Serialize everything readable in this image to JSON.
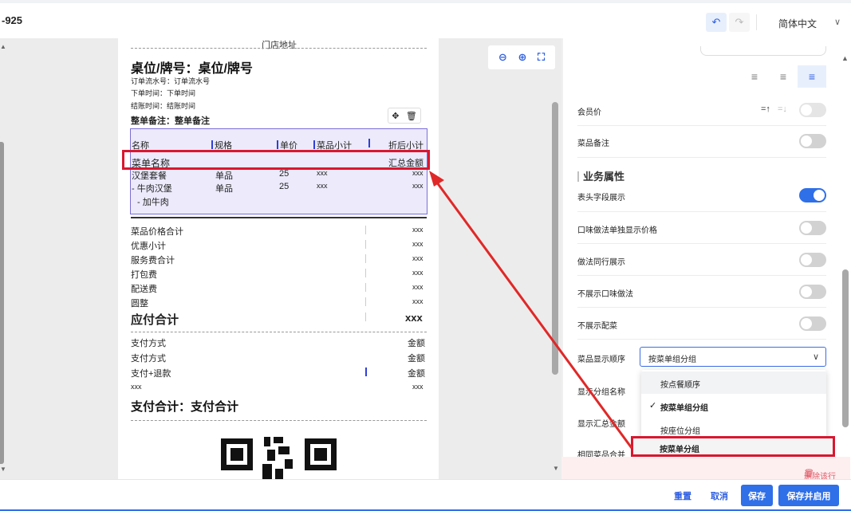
{
  "header": {
    "title": "-925",
    "undo_icon": "undo-icon",
    "redo_icon": "redo-icon",
    "language": "简体中文"
  },
  "zoom_tools": {
    "zoom_out": "zoom-out-icon",
    "zoom_in": "zoom-in-icon",
    "fit": "fit-screen-icon"
  },
  "receipt": {
    "store_address": "门店地址",
    "table_no": "桌位/牌号：桌位/牌号",
    "serial": "订单流水号：订单流水号",
    "order_time": "下单时间：下单时间",
    "checkout_time": "结账时间：结账时间",
    "order_note": "整单备注：整单备注",
    "item_headers": [
      "名称",
      "规格",
      "单价",
      "菜品小计",
      "折后小计"
    ],
    "group_name": "菜单名称",
    "group_total": "汇总金额",
    "items": [
      {
        "name": "汉堡套餐",
        "spec": "单品",
        "price": "25",
        "subtotal": "xxx",
        "discounted": "xxx"
      },
      {
        "name": "- 牛肉汉堡",
        "spec": "单品",
        "price": "25",
        "subtotal": "xxx",
        "discounted": "xxx"
      }
    ],
    "addon": "- 加牛肉",
    "totals": [
      {
        "label": "菜品价格合计",
        "value": "xxx"
      },
      {
        "label": "优惠小计",
        "value": "xxx"
      },
      {
        "label": "服务费合计",
        "value": "xxx"
      },
      {
        "label": "打包费",
        "value": "xxx"
      },
      {
        "label": "配送费",
        "value": "xxx"
      },
      {
        "label": "圆整",
        "value": "xxx"
      }
    ],
    "amount_due_label": "应付合计",
    "amount_due_value": "xxx",
    "payments": [
      {
        "label": "支付方式",
        "value": "金额"
      },
      {
        "label": "支付方式",
        "value": "金额"
      },
      {
        "label": "支付+退款",
        "value": "金额"
      },
      {
        "label": "xxx",
        "value": "xxx"
      }
    ],
    "pay_total": "支付合计：支付合计"
  },
  "right_panel": {
    "member_price": "会员价",
    "dish_note": "菜品备注",
    "section_business": "业务属性",
    "header_display": "表头字段展示",
    "flavor_separate_price": "口味做法单独显示价格",
    "method_same_line": "做法同行展示",
    "hide_flavor": "不展示口味做法",
    "hide_side_dish": "不展示配菜",
    "dish_order_label": "菜品显示顺序",
    "dish_order_value": "按菜单组分组",
    "show_group_name": "显示分组名称",
    "show_total_amount": "显示汇总金额",
    "merge_same_dish": "相同菜品合并",
    "dropdown_options": [
      "按点餐顺序",
      "按菜单组分组",
      "按座位分组",
      "按菜单分组"
    ],
    "delete_row": "删除该行"
  },
  "footer": {
    "reset": "重置",
    "cancel": "取消",
    "save": "保存",
    "save_enable": "保存并启用"
  },
  "colors": {
    "accent": "#2f6fe8",
    "annotation_red": "#d9172f",
    "table_bg": "#eceafb"
  }
}
